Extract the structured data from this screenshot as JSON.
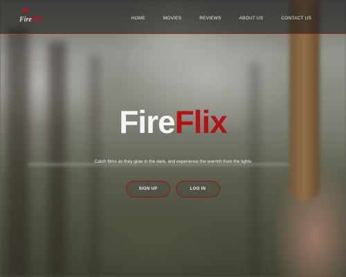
{
  "brand": {
    "logo_fire": "Fire",
    "logo_flix": "Flix",
    "logo_icon": "star-icon",
    "accent_color": "#b01414"
  },
  "nav": {
    "items": [
      {
        "label": "HOME"
      },
      {
        "label": "MOVIES"
      },
      {
        "label": "REVIEWS"
      },
      {
        "label": "ABOUT US"
      },
      {
        "label": "CONTACT US"
      }
    ]
  },
  "hero": {
    "title_fire": "Fire",
    "title_flix": "Flix",
    "tagline": "Catch films as they glow in the dark, and experience the warmth from the lights",
    "signup_label": "SIGN UP",
    "login_label": "LOG IN"
  }
}
